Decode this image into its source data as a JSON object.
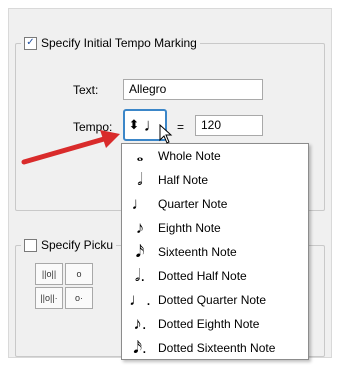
{
  "specify_tempo": {
    "label": "Specify Initial Tempo Marking",
    "checked": true
  },
  "text_field": {
    "label": "Text:",
    "value": "Allegro"
  },
  "tempo": {
    "label": "Tempo:",
    "selected_icon": "quarter-note-icon",
    "equals": "=",
    "value": "120"
  },
  "pickup": {
    "label": "Specify Picku",
    "checked": false
  },
  "pickup_buttons": [
    "||o||",
    "o",
    "||o||·",
    "o·"
  ],
  "dropdown": [
    {
      "label": "Whole Note",
      "icon": "whole-note-icon",
      "glyph": "𝅝"
    },
    {
      "label": "Half Note",
      "icon": "half-note-icon",
      "glyph": "𝅗𝅥"
    },
    {
      "label": "Quarter Note",
      "icon": "quarter-note-icon",
      "glyph": "♩"
    },
    {
      "label": "Eighth Note",
      "icon": "eighth-note-icon",
      "glyph": "♪"
    },
    {
      "label": "Sixteenth Note",
      "icon": "sixteenth-note-icon",
      "glyph": "𝅘𝅥𝅯"
    },
    {
      "label": "Dotted Half Note",
      "icon": "dotted-half-note-icon",
      "glyph": "𝅗𝅥."
    },
    {
      "label": "Dotted Quarter Note",
      "icon": "dotted-quarter-note-icon",
      "glyph": "♩."
    },
    {
      "label": "Dotted Eighth Note",
      "icon": "dotted-eighth-note-icon",
      "glyph": "♪."
    },
    {
      "label": "Dotted Sixteenth Note",
      "icon": "dotted-sixteenth-note-icon",
      "glyph": "𝅘𝅥𝅯."
    }
  ],
  "colors": {
    "arrow": "#d92b2b",
    "focus_border": "#3b86c8",
    "checkmark": "#1f4fa0"
  }
}
